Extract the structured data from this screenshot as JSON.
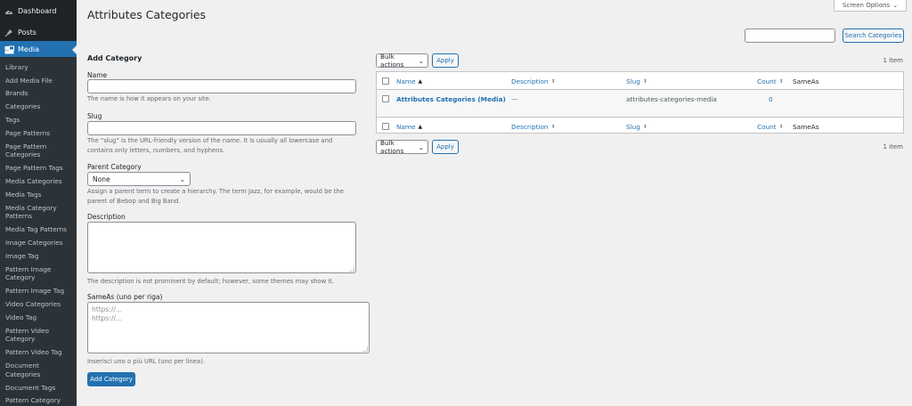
{
  "sidebar": {
    "top_items": [
      {
        "label": "Dashboard",
        "icon": "dashboard-icon"
      },
      {
        "label": "Posts",
        "icon": "pin-icon"
      },
      {
        "label": "Media",
        "icon": "media-icon"
      }
    ],
    "submenu": [
      "Library",
      "Add Media File",
      "Brands",
      "Categories",
      "Tags",
      "Page Patterns",
      "Page Pattern Categories",
      "Page Pattern Tags",
      "Media Categories",
      "Media Tags",
      "Media Category Patterns",
      "Media Tag Patterns",
      "Image Categories",
      "Image Tag",
      "Pattern Image Category",
      "Pattern Image Tag",
      "Video Categories",
      "Video Tag",
      "Pattern Video Category",
      "Pattern Video Tag",
      "Document Categories",
      "Document Tags",
      "Pattern Category Documents"
    ]
  },
  "header": {
    "title": "Attributes Categories",
    "screen_options": "Screen Options"
  },
  "search": {
    "value": "",
    "button": "Search Categories"
  },
  "form": {
    "heading": "Add Category",
    "name_label": "Name",
    "name_value": "",
    "name_help": "The name is how it appears on your site.",
    "slug_label": "Slug",
    "slug_value": "",
    "slug_help": "The “slug” is the URL-friendly version of the name. It is usually all lowercase and contains only letters, numbers, and hyphens.",
    "parent_label": "Parent Category",
    "parent_value": "None",
    "parent_help": "Assign a parent term to create a hierarchy. The term Jazz, for example, would be the parent of Bebop and Big Band.",
    "description_label": "Description",
    "description_help": "The description is not prominent by default; however, some themes may show it.",
    "sameas_label": "SameAs (uno per riga)",
    "sameas_placeholder_1": "https://...",
    "sameas_placeholder_2": "https://...",
    "sameas_help": "Inserisci uno o più URL (uno per linea).",
    "submit": "Add Category"
  },
  "table": {
    "bulk_actions": "Bulk actions",
    "apply": "Apply",
    "item_count": "1 item",
    "columns": {
      "name": "Name",
      "description": "Description",
      "slug": "Slug",
      "count": "Count",
      "sameas": "SameAs"
    },
    "rows": [
      {
        "name": "Attributes Categories (Media)",
        "description": "—",
        "slug": "attributes-categories-media",
        "count": "0",
        "sameas": ""
      }
    ]
  },
  "colors": {
    "sidebar_bg": "#1d2327",
    "accent": "#2271b1",
    "page_bg": "#f0f0f1"
  }
}
